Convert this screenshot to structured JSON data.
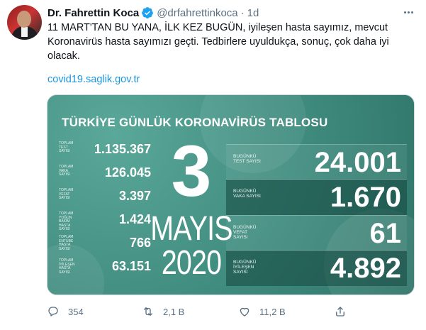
{
  "author": {
    "name": "Dr. Fahrettin Koca",
    "handle": "@drfahrettinkoca",
    "separator": "·",
    "time": "1d"
  },
  "tweet": {
    "text": "11 MART'TAN BU YANA, İLK KEZ BUGÜN, iyileşen hasta sayımız, mevcut Koronavirüs hasta sayımızı geçti. Tedbirlere uyuldukça, sonuç, çok daha iyi olacak.",
    "link": "covid19.saglik.gov.tr"
  },
  "card": {
    "title": "TÜRKİYE GÜNLÜK KORONAVİRÜS TABLOSU",
    "totals": [
      {
        "label": "TOPLAM TEST SAYISI",
        "value": "1.135.367"
      },
      {
        "label": "TOPLAM VAKA SAYISI",
        "value": "126.045"
      },
      {
        "label": "TOPLAM VEFAT SAYISI",
        "value": "3.397"
      },
      {
        "label": "TOPLAM YOĞUN BAKIM HASTA SAYISI",
        "value": "1.424"
      },
      {
        "label": "TOPLAM ENTÜBE HASTA SAYISI",
        "value": "766"
      },
      {
        "label": "TOPLAM İYİLEŞEN HASTA SAYISI",
        "value": "63.151"
      }
    ],
    "day": "3",
    "month": "MAYIS",
    "year": "2020",
    "daily": [
      {
        "label": "BUGÜNKÜ TEST SAYISI",
        "value": "24.001"
      },
      {
        "label": "BUGÜNKÜ VAKA SAYISI",
        "value": "1.670"
      },
      {
        "label": "BUGÜNKÜ VEFAT SAYISI",
        "value": "61"
      },
      {
        "label": "BUGÜNKÜ İYİLEŞEN SAYISI",
        "value": "4.892"
      }
    ],
    "colors": {
      "background": "#4d9a8c",
      "dark_row": "#1f5d53"
    }
  },
  "actions": {
    "reply_count": "354",
    "retweet_count": "2,1 B",
    "like_count": "11,2 B",
    "reply_icon": "reply-icon",
    "retweet_icon": "retweet-icon",
    "like_icon": "heart-icon",
    "share_icon": "share-icon"
  },
  "colors": {
    "link": "#1b95e0",
    "muted": "#5b7083",
    "verified": "#1da1f2"
  }
}
